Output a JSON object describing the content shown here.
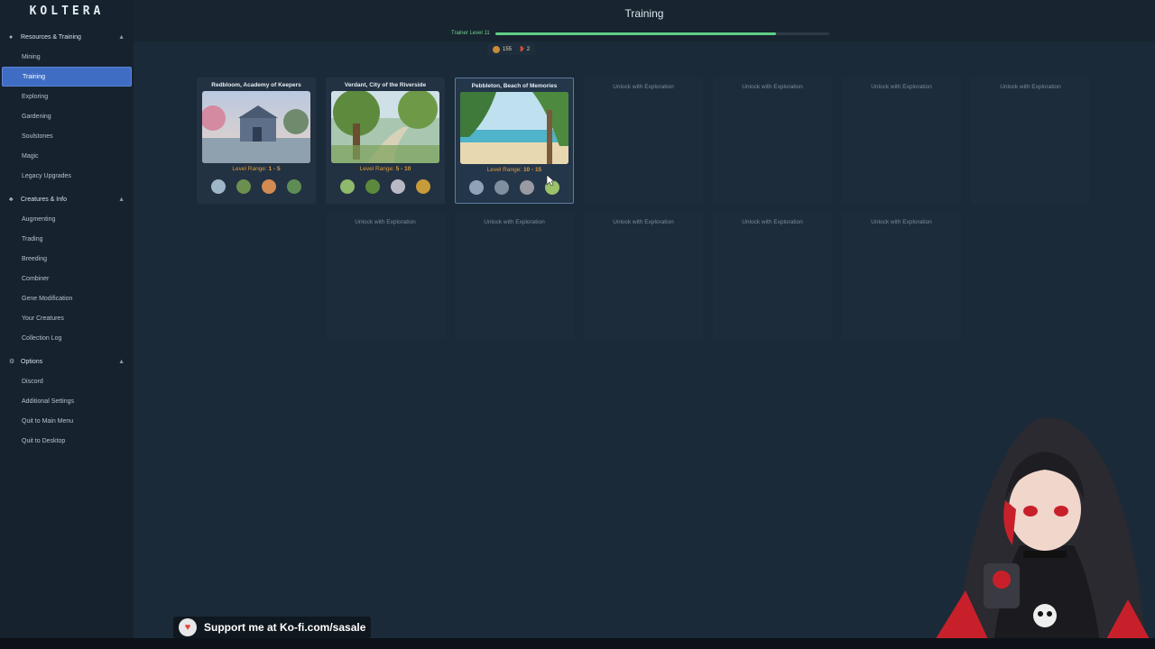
{
  "app": {
    "logo": "KOLTERA",
    "page_title": "Training"
  },
  "sidebar": {
    "sections": [
      {
        "label": "Resources & Training",
        "icon": "pin-icon",
        "items": [
          "Mining",
          "Training",
          "Exploring",
          "Gardening",
          "Soulstones",
          "Magic",
          "Legacy Upgrades"
        ]
      },
      {
        "label": "Creatures & Info",
        "icon": "creature-icon",
        "items": [
          "Augmenting",
          "Trading",
          "Breeding",
          "Combiner",
          "Gene Modification",
          "Your Creatures",
          "Collection Log"
        ]
      },
      {
        "label": "Options",
        "icon": "gear-icon",
        "items": [
          "Discord",
          "Additional Settings",
          "Quit to Main Menu",
          "Quit to Desktop"
        ]
      }
    ],
    "active_item": "Training"
  },
  "trainer": {
    "label": "Trainer Level 11",
    "xp_progress": 0.84
  },
  "currency": {
    "coins": "155",
    "chili": "2"
  },
  "locations": [
    {
      "name": "Redbloom, Academy of Keepers",
      "level_label": "Level Range:",
      "level_range": "1 - 5"
    },
    {
      "name": "Verdant, City of the Riverside",
      "level_label": "Level Range:",
      "level_range": "5 - 10"
    },
    {
      "name": "Pebbleton, Beach of Memories",
      "level_label": "Level Range:",
      "level_range": "10 - 15"
    }
  ],
  "locked_label": "Unlock with Exploration",
  "support": {
    "text": "Support me at Ko-fi.com/sasale"
  },
  "colors": {
    "accent": "#3f6dc4",
    "xp": "#5fcf86",
    "level": "#e09a3a"
  }
}
